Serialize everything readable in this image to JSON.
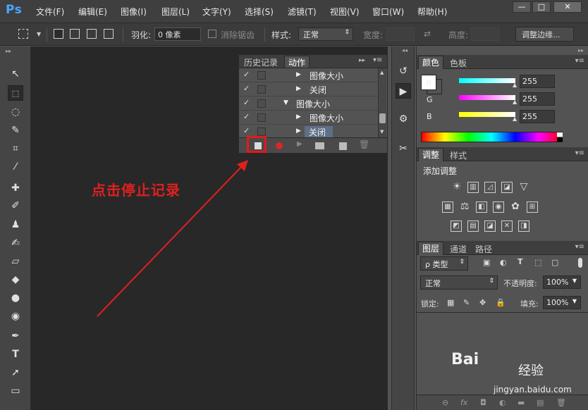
{
  "app": {
    "logo": "Ps"
  },
  "menu": [
    "文件(F)",
    "编辑(E)",
    "图像(I)",
    "图层(L)",
    "文字(Y)",
    "选择(S)",
    "滤镜(T)",
    "视图(V)",
    "窗口(W)",
    "帮助(H)"
  ],
  "window_controls": {
    "minimize": "—",
    "maximize": "□",
    "close": "✕"
  },
  "options": {
    "feather_label": "羽化:",
    "feather_value": "0 像素",
    "antialias_label": "消除锯齿",
    "style_label": "样式:",
    "style_value": "正常",
    "width_label": "宽度:",
    "height_label": "高度:",
    "refine_button": "调整边缘..."
  },
  "actions_panel": {
    "tabs": [
      "历史记录",
      "动作"
    ],
    "rows": [
      {
        "label": "图像大小",
        "check": "✓",
        "indent": 2,
        "expanded": false
      },
      {
        "label": "关闭",
        "check": "✓",
        "indent": 2,
        "expanded": false
      },
      {
        "label": "图像大小",
        "check": "✓",
        "indent": 1,
        "expanded": true
      },
      {
        "label": "图像大小",
        "check": "✓",
        "indent": 2,
        "expanded": false
      },
      {
        "label": "关闭",
        "check": "✓",
        "indent": 2,
        "expanded": false,
        "selected": true
      }
    ]
  },
  "annotation": {
    "text": "点击停止记录",
    "color": "#e02020"
  },
  "color_panel": {
    "tabs": [
      "颜色",
      "色板"
    ],
    "channels": [
      {
        "label": "R",
        "value": "255",
        "gradient": "linear-gradient(90deg,#00ffff,#ffffff)"
      },
      {
        "label": "G",
        "value": "255",
        "gradient": "linear-gradient(90deg,#ff00ff,#ffffff)"
      },
      {
        "label": "B",
        "value": "255",
        "gradient": "linear-gradient(90deg,#ffff00,#ffffff)"
      }
    ]
  },
  "adjustments_panel": {
    "tabs": [
      "调整",
      "样式"
    ],
    "title": "添加调整"
  },
  "layers_panel": {
    "tabs": [
      "图层",
      "通道",
      "路径"
    ],
    "filter_label": "ρ 类型",
    "blend_mode": "正常",
    "opacity_label": "不透明度:",
    "opacity_value": "100%",
    "lock_label": "锁定:",
    "fill_label": "填充:",
    "fill_value": "100%"
  },
  "watermark": {
    "logo": "Bai",
    "brand": "经验",
    "url": "jingyan.baidu.com"
  }
}
